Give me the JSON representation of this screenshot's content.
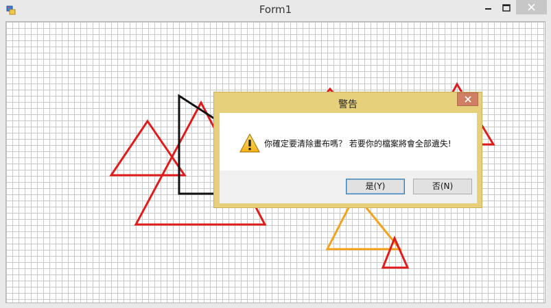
{
  "window": {
    "title": "Form1",
    "icon": "winforms-app-icon",
    "controls": [
      "minimize-icon",
      "maximize-icon",
      "close-icon"
    ]
  },
  "canvas": {
    "background": "#ffffff",
    "grid_color": "#c8c8c8",
    "shapes": [
      {
        "kind": "triangle",
        "color": "#e01b1b"
      },
      {
        "kind": "triangle",
        "color": "#e01b1b"
      },
      {
        "kind": "rectangle",
        "color": "#000000"
      },
      {
        "kind": "triangle",
        "color": "#e01b1b"
      },
      {
        "kind": "triangle",
        "color": "#e01b1b"
      },
      {
        "kind": "triangle",
        "color": "#f5a21b"
      },
      {
        "kind": "triangle",
        "color": "#e01b1b"
      }
    ]
  },
  "dialog": {
    "title": "警告",
    "message": "你確定要清除畫布嗎？ 若要你的檔案將會全部遺失!",
    "icon": "warning-icon",
    "yes_label": "是(Y)",
    "no_label": "否(N)",
    "frame_color": "#e7d07c",
    "close_color": "#cf8064"
  }
}
